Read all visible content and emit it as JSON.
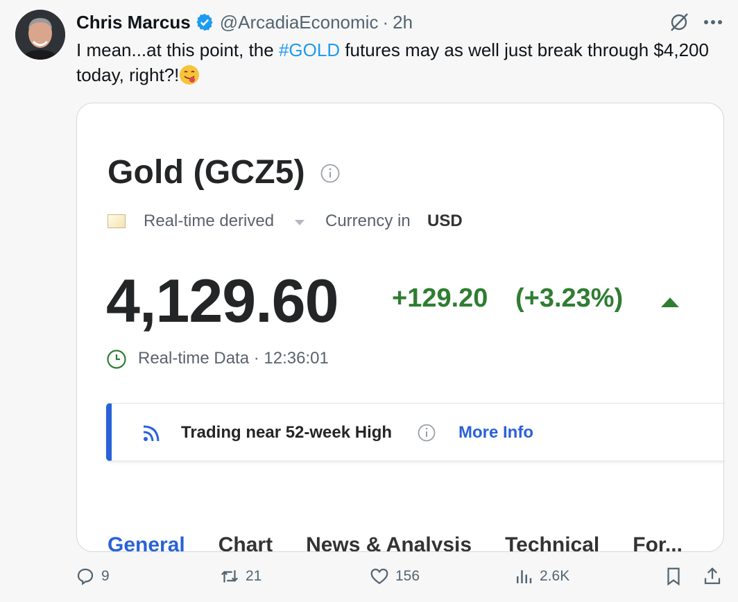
{
  "tweet": {
    "author_name": "Chris Marcus",
    "handle": "@ArcadiaEconomic",
    "separator": "·",
    "time": "2h",
    "text_before": "I mean...at this point, the ",
    "hashtag": "#GOLD",
    "text_after": " futures may as well just break through $4,200 today, right?!",
    "emoji": "face-savoring-food-emoji"
  },
  "card": {
    "title": "Gold (GCZ5)",
    "realtime_label": "Real-time derived",
    "currency_label": "Currency in",
    "currency_value": "USD",
    "price": "4,129.60",
    "change": "+129.20",
    "change_pct": "(+3.23%)",
    "data_time": "Real-time Data · 12:36:01",
    "banner_text": "Trading near 52-week High",
    "more_info": "More Info",
    "tabs": [
      "General",
      "Chart",
      "News & Analysis",
      "Technical",
      "For..."
    ]
  },
  "actions": {
    "replies": "9",
    "reposts": "21",
    "likes": "156",
    "views": "2.6K"
  },
  "colors": {
    "accent": "#1d9bf0",
    "positive": "#2f7d32",
    "link": "#2962d8",
    "muted": "#536471"
  }
}
